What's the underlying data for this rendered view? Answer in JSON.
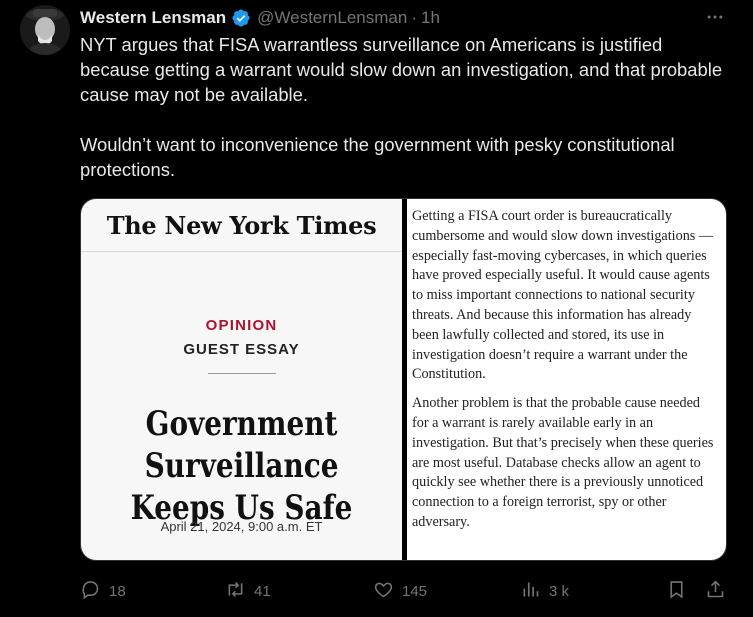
{
  "tweet": {
    "author_name": "Western Lensman",
    "handle": "@WesternLensman",
    "separator": "·",
    "time": "1h",
    "paragraphs": [
      "NYT argues that FISA warrantless surveillance on Americans is justified because getting a warrant would slow down an investigation, and that probable cause may not be available.",
      "Wouldn’t want to inconvenience the government with pesky constitutional protections."
    ]
  },
  "media": {
    "logo_text": "The New York Times",
    "section": "OPINION",
    "kicker": "GUEST ESSAY",
    "headline_line1": "Government Surveillance",
    "headline_line2": "Keeps Us Safe",
    "date": "April 21, 2024, 9:00 a.m. ET",
    "excerpt": [
      "Getting a FISA court order is bureaucratically cumbersome and would slow down investigations — especially fast-moving cybercases, in which queries have proved especially useful. It would cause agents to miss important connections to national security threats. And because this information has already been lawfully collected and stored, its use in investigation doesn’t require a warrant under the Constitution.",
      "Another problem is that the probable cause needed for a warrant is rarely available early in an investigation. But that’s precisely when these queries are most useful. Database checks allow an agent to quickly see whether there is a previously unnoticed connection to a foreign terrorist, spy or other adversary."
    ]
  },
  "actions": {
    "replies": "18",
    "reposts": "41",
    "likes": "145",
    "views": "3 k"
  },
  "icons": {
    "verified": "verified-badge-icon",
    "more": "more-icon",
    "reply": "reply-icon",
    "repost": "repost-icon",
    "like": "heart-icon",
    "views": "views-icon",
    "bookmark": "bookmark-icon",
    "share": "share-icon"
  },
  "colors": {
    "background": "#000000",
    "text": "#e7e9ea",
    "secondary": "#71767b",
    "verified": "#1d9bf0",
    "opinion_red": "#b0112a"
  }
}
